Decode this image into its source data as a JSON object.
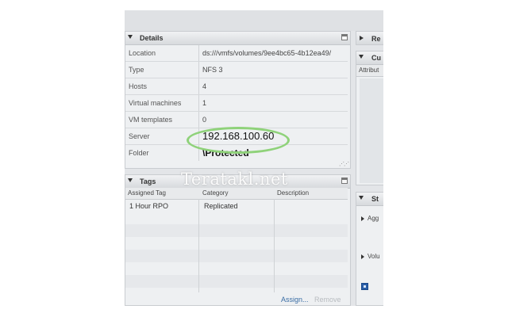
{
  "details": {
    "title": "Details",
    "rows": [
      {
        "label": "Location",
        "value": "ds:///vmfs/volumes/9ee4bc65-4b12ea49/"
      },
      {
        "label": "Type",
        "value": "NFS 3"
      },
      {
        "label": "Hosts",
        "value": "4"
      },
      {
        "label": "Virtual machines",
        "value": "1"
      },
      {
        "label": "VM templates",
        "value": "0"
      },
      {
        "label": "Server",
        "value": "192.168.100.60"
      },
      {
        "label": "Folder",
        "value": "\\Protected"
      }
    ]
  },
  "tags": {
    "title": "Tags",
    "columns": [
      "Assigned Tag",
      "Category",
      "Description"
    ],
    "rows": [
      {
        "tag": "1 Hour RPO",
        "category": "Replicated",
        "description": ""
      }
    ],
    "assign_label": "Assign...",
    "remove_label": "Remove"
  },
  "right": {
    "panel1_title": "Re",
    "panel2_title": "Cu",
    "panel2_column": "Attribut",
    "panel3_title": "St",
    "item1": "Agg",
    "item2": "Volu"
  },
  "watermark": "Teratakl.net",
  "colors": {
    "highlight_ellipse": "#8fd27a",
    "link": "#3b6ea5",
    "icon_blue": "#2a5ea8"
  }
}
